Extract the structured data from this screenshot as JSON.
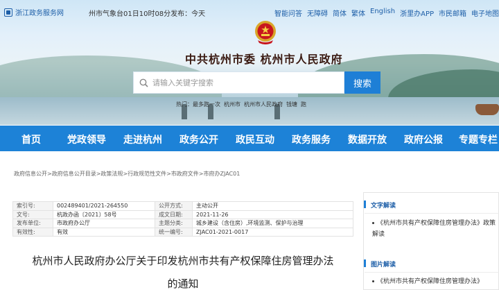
{
  "topbar": {
    "gov_service": "浙江政务服务网",
    "weather": "州市气象台01日10时08分发布：今天",
    "links": [
      "智能问答",
      "无障碍",
      "简体",
      "繁体",
      "English",
      "浙里办APP",
      "市民邮箱",
      "电子地图",
      "用"
    ]
  },
  "header": {
    "site_title": "中共杭州市委  杭州市人民政府"
  },
  "search": {
    "placeholder": "请输入关键字搜索",
    "button_label": "搜索",
    "hot_words": [
      "热门：最多跑一次",
      "杭州市",
      "杭州市人民政府",
      "钱塘",
      "跑"
    ]
  },
  "nav": {
    "items": [
      "首页",
      "党政领导",
      "走进杭州",
      "政务公开",
      "政民互动",
      "政务服务",
      "数据开放",
      "政府公报",
      "专题专栏"
    ]
  },
  "breadcrumb": "政府信息公开>政府信息公开目录>政策法规>行政规范性文件>市政府文件>市府办ZJAC01",
  "meta": {
    "rows": [
      [
        "索引号:",
        "002489401/2021-264550",
        "公开方式:",
        "主动公开"
      ],
      [
        "文号:",
        "杭政办函〔2021〕58号",
        "成文日期:",
        "2021-11-26"
      ],
      [
        "发布单位:",
        "市政府办公厅",
        "主题分类:",
        "城乡建设（含住房）,环境监测、保护与治理"
      ],
      [
        "有效性:",
        "有效",
        "统一编号:",
        "ZJAC01-2021-0017"
      ]
    ]
  },
  "document": {
    "title_line1": "杭州市人民政府办公厅关于印发杭州市共有产权保障住房管理办法",
    "title_line2": "的通知"
  },
  "sidebar": {
    "text_head": "文字解读",
    "text_items": [
      "《杭州市共有产权保障住房管理办法》政策解读"
    ],
    "pic_head": "图片解读",
    "pic_items": [
      "《杭州市共有产权保障住房管理办法》"
    ]
  },
  "colors": {
    "nav_bg": "#1d82d7",
    "search_button": "#1e7fd6",
    "link_blue": "#1e5fa8"
  }
}
